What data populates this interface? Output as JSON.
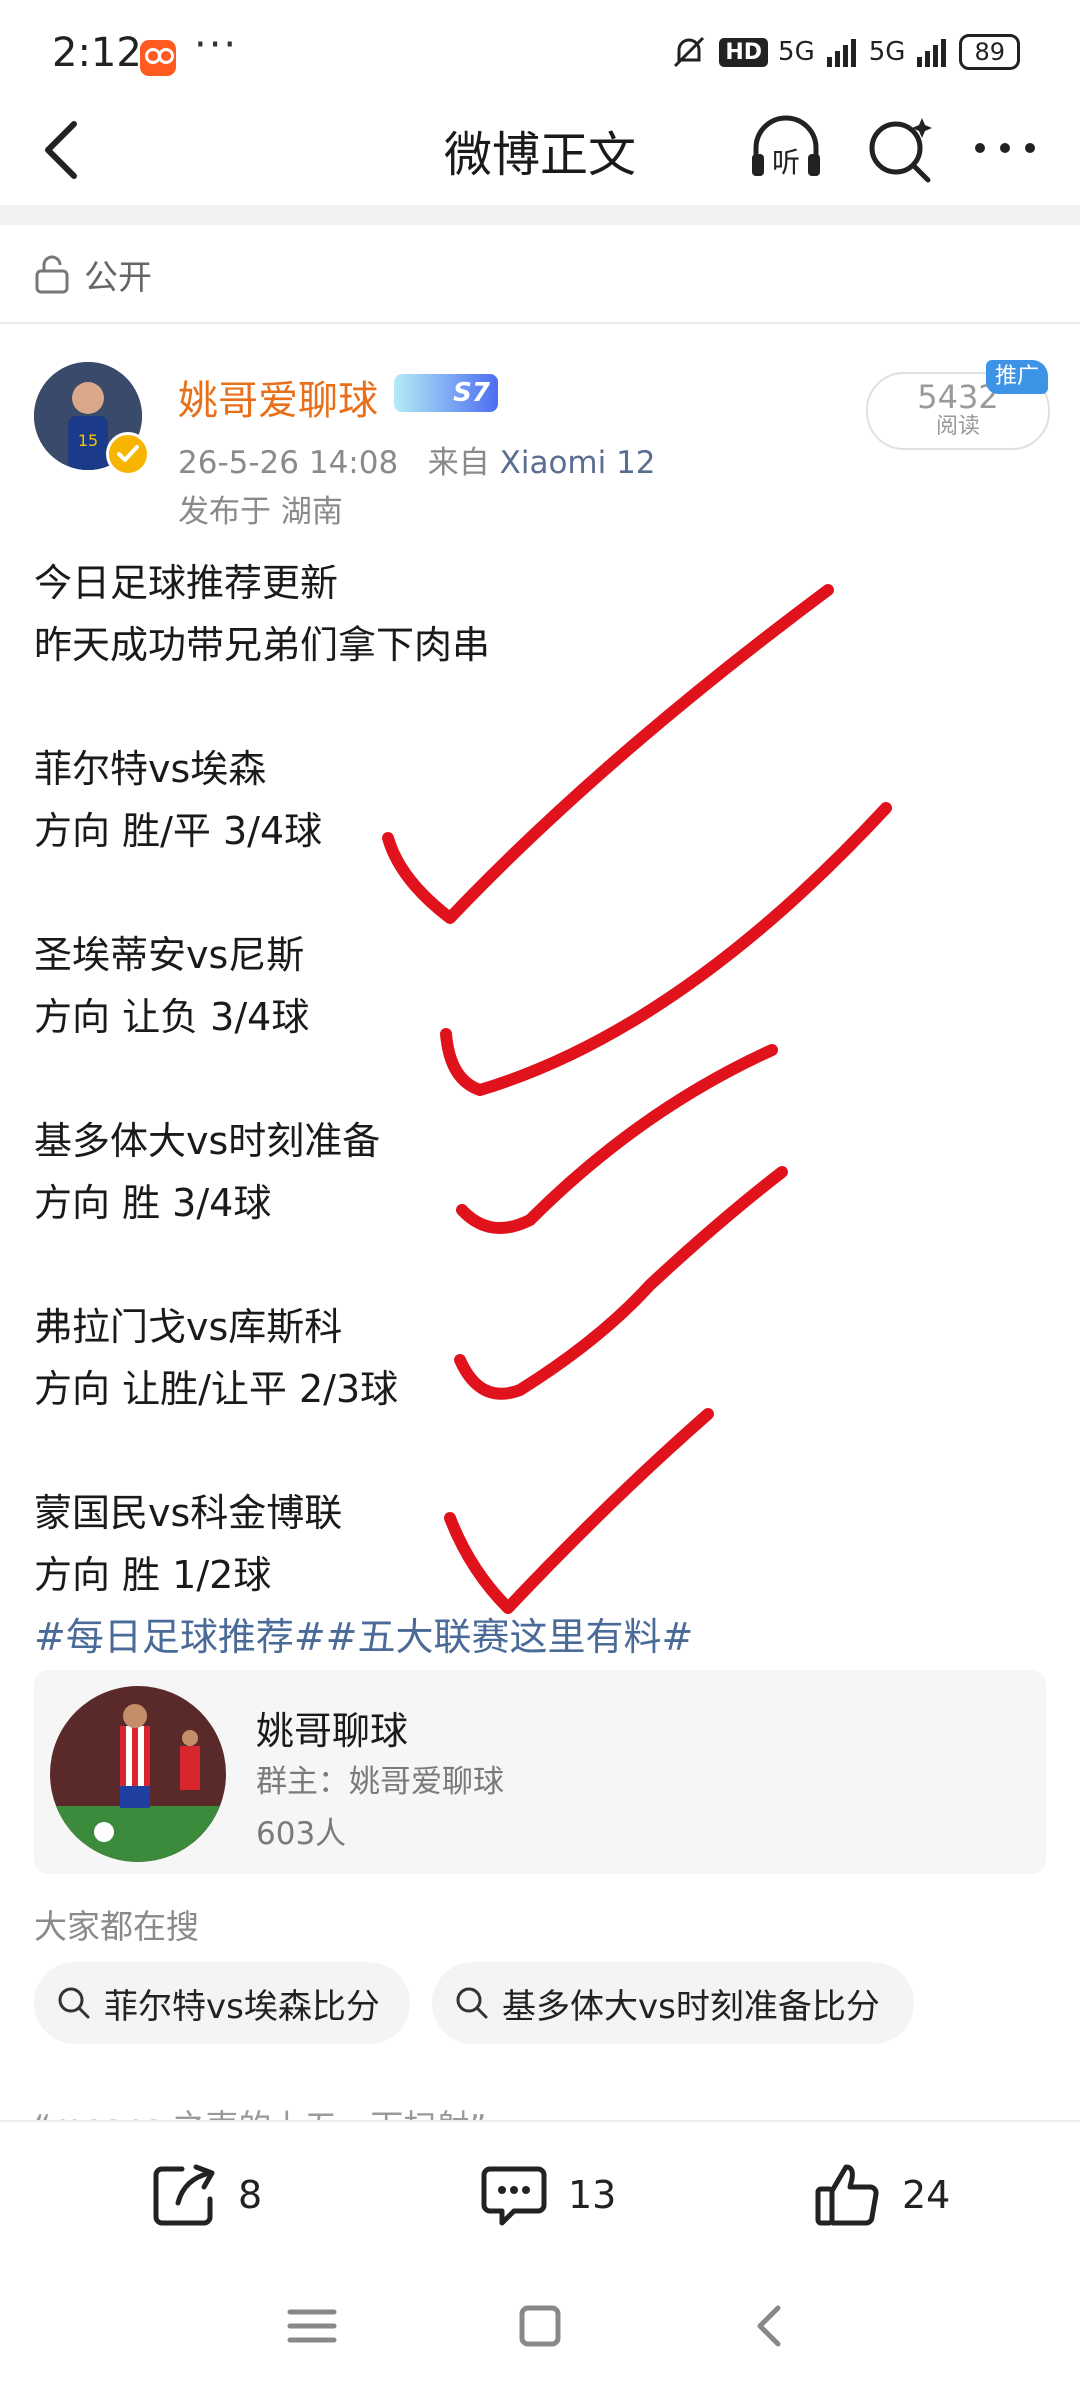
{
  "status_bar": {
    "time": "2:12",
    "dots": "···",
    "hd": "HD",
    "net1": "5G",
    "net2": "5G",
    "battery": "89"
  },
  "header": {
    "title": "微博正文",
    "listen_label": "听"
  },
  "privacy": {
    "label": "公开"
  },
  "author": {
    "name": "姚哥爱聊球",
    "level": "S7",
    "time": "26-5-26 14:08",
    "source_prefix": "来自",
    "device": "Xiaomi 12",
    "location": "发布于 湖南",
    "read_count": "5432",
    "read_label": "阅读",
    "ad_tag": "推广"
  },
  "post": {
    "lines": [
      "今日足球推荐更新",
      "昨天成功带兄弟们拿下肉串",
      "菲尔特vs埃森",
      "方向 胜/平 3/4球",
      "圣埃蒂安vs尼斯",
      "方向 让负 3/4球",
      "基多体大vs时刻准备",
      "方向 胜 3/4球",
      "弗拉门戈vs库斯科",
      "方向 让胜/让平 2/3球",
      "蒙国民vs科金博联",
      "方向 胜 1/2球"
    ],
    "tags": "#每日足球推荐##五大联赛这里有料#"
  },
  "group": {
    "name": "姚哥聊球",
    "owner": "群主：姚哥爱聊球",
    "members": "603人"
  },
  "search": {
    "heading": "大家都在搜",
    "chips": [
      "菲尔特vs埃森比分",
      "基多体大vs时刻准备比分"
    ]
  },
  "next_peek": "“means 之声的上五一下扫射”",
  "actions": {
    "repost_count": "8",
    "comment_count": "13",
    "like_count": "24"
  },
  "colors": {
    "author_name": "#e8701a",
    "tag_link": "#4a6a98",
    "check_marks": "#e0121c",
    "ad_tag": "#3d94e6"
  }
}
